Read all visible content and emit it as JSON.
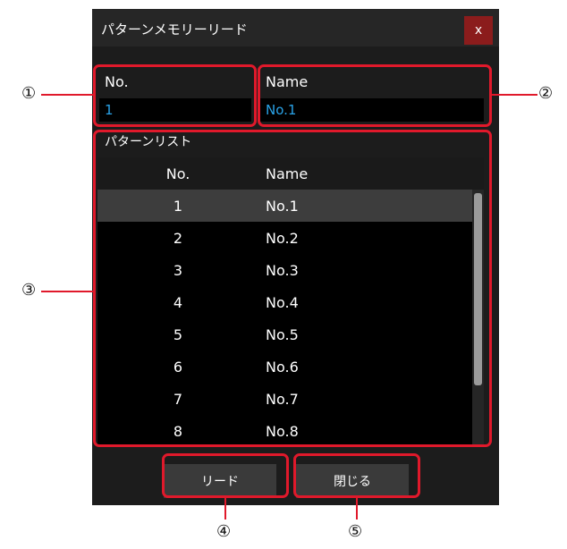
{
  "dialog": {
    "title": "パターンメモリーリード",
    "close_label": "x"
  },
  "no_group": {
    "label": "No.",
    "value": "1"
  },
  "name_group": {
    "label": "Name",
    "value": "No.1"
  },
  "pattern_list": {
    "label": "パターンリスト",
    "headers": {
      "no": "No.",
      "name": "Name"
    },
    "selected_index": 0,
    "rows": [
      {
        "no": "1",
        "name": "No.1"
      },
      {
        "no": "2",
        "name": "No.2"
      },
      {
        "no": "3",
        "name": "No.3"
      },
      {
        "no": "4",
        "name": "No.4"
      },
      {
        "no": "5",
        "name": "No.5"
      },
      {
        "no": "6",
        "name": "No.6"
      },
      {
        "no": "7",
        "name": "No.7"
      },
      {
        "no": "8",
        "name": "No.8"
      }
    ]
  },
  "buttons": {
    "read": "リード",
    "close": "閉じる"
  },
  "callouts": {
    "c1": "①",
    "c2": "②",
    "c3": "③",
    "c4": "④",
    "c5": "⑤"
  },
  "colors": {
    "highlight": "#e0192b",
    "value_text": "#2aa3e8",
    "close_button": "#8b1c1c"
  }
}
